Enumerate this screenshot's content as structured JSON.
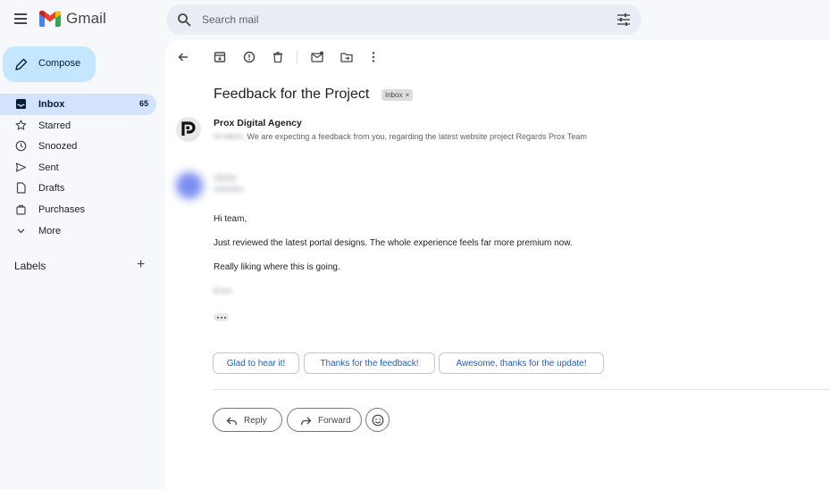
{
  "app": {
    "name": "Gmail"
  },
  "search": {
    "placeholder": "Search mail"
  },
  "compose": {
    "label": "Compose"
  },
  "sidebar": {
    "items": [
      {
        "label": "Inbox",
        "count": "65",
        "icon": "inbox-icon",
        "active": true
      },
      {
        "label": "Starred",
        "count": "",
        "icon": "star-icon"
      },
      {
        "label": "Snoozed",
        "count": "",
        "icon": "clock-icon"
      },
      {
        "label": "Sent",
        "count": "",
        "icon": "send-icon"
      },
      {
        "label": "Drafts",
        "count": "",
        "icon": "draft-icon"
      },
      {
        "label": "Purchases",
        "count": "",
        "icon": "shopping-bag-icon"
      },
      {
        "label": "More",
        "count": "",
        "icon": "chevron-down-icon"
      }
    ],
    "labels_heading": "Labels",
    "labels_add": "+"
  },
  "toolbar": {
    "icons": [
      "back-arrow-icon",
      "archive-icon",
      "report-spam-icon",
      "delete-icon",
      "mark-unread-icon",
      "move-to-icon",
      "more-vert-icon"
    ]
  },
  "message": {
    "subject": "Feedback for the Project",
    "tag": "Inbox",
    "tag_close": "×",
    "sender": "Prox Digital Agency",
    "snippet_prefix": "Hi Mitch,",
    "snippet": "We are expecting a feedback from you, regarding the latest website project Regards Prox Team",
    "body": {
      "greeting": "Hi team,",
      "line1": "Just reviewed the latest portal designs. The whole experience feels far more premium now.",
      "line2": "Really liking where this is going.",
      "signature": "Eren"
    }
  },
  "smart_replies": [
    "Glad to hear it!",
    "Thanks for the feedback!",
    "Awesome, thanks for the update!"
  ],
  "actions": {
    "reply": "Reply",
    "forward": "Forward"
  },
  "colors": {
    "accent": "#0b57d0",
    "compose_bg": "#c2e7ff",
    "active_nav": "#d3e3fd",
    "chip_text": "#1a5ecc"
  }
}
